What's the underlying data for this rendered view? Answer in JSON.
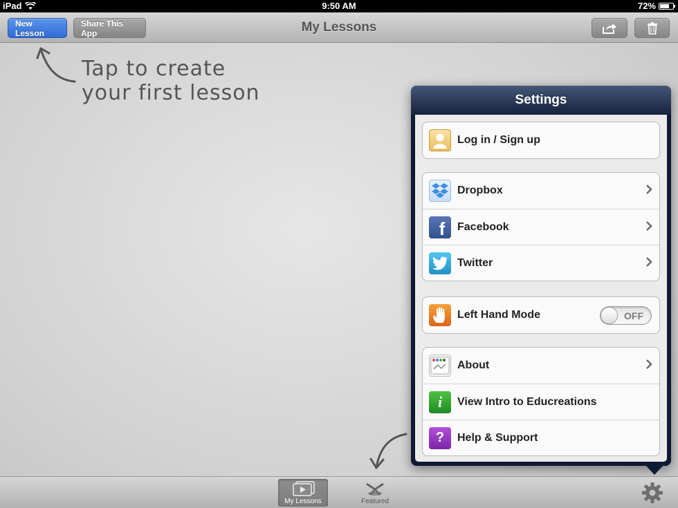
{
  "status_bar": {
    "device": "iPad",
    "time": "9:50 AM",
    "battery": "72%",
    "battery_level": 0.72
  },
  "toolbar": {
    "new_lesson_label": "New Lesson",
    "share_label": "Share This App",
    "title": "My Lessons",
    "share_icon": "share-icon",
    "trash_icon": "trash-icon"
  },
  "hint": {
    "line1": "Tap to create",
    "line2": "your first lesson"
  },
  "settings": {
    "title": "Settings",
    "groups": [
      {
        "rows": [
          {
            "label": "Log in / Sign up",
            "icon": "user-icon"
          }
        ]
      },
      {
        "rows": [
          {
            "label": "Dropbox",
            "icon": "dropbox-icon",
            "chevron": true
          },
          {
            "label": "Facebook",
            "icon": "facebook-icon",
            "chevron": true
          },
          {
            "label": "Twitter",
            "icon": "twitter-icon",
            "chevron": true
          }
        ]
      },
      {
        "rows": [
          {
            "label": "Left Hand Mode",
            "icon": "hand-icon",
            "toggle": "OFF"
          }
        ]
      },
      {
        "rows": [
          {
            "label": "About",
            "icon": "about-icon",
            "chevron": true
          },
          {
            "label": "View Intro to Educreations",
            "icon": "info-icon"
          },
          {
            "label": "Help & Support",
            "icon": "help-icon"
          }
        ]
      }
    ]
  },
  "bottom_bar": {
    "tabs": [
      {
        "label": "My Lessons",
        "active": true,
        "icon": "my-lessons-icon"
      },
      {
        "label": "Featured",
        "active": false,
        "icon": "featured-icon"
      }
    ],
    "gear_icon": "gear-icon"
  },
  "colors": {
    "primary_button": "#2f6bd6",
    "popover_frame": "#0e1a33"
  }
}
